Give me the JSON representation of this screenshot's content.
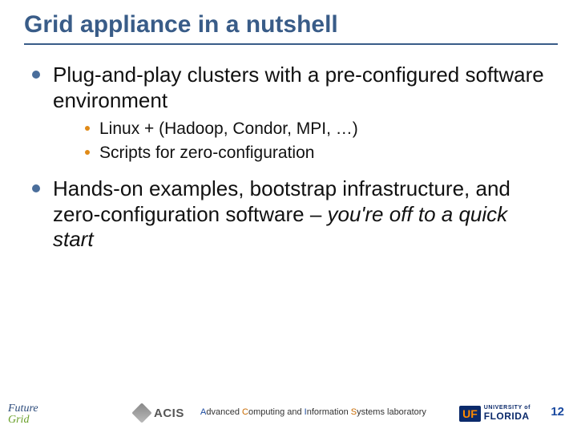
{
  "title": "Grid appliance in a nutshell",
  "bullets": [
    {
      "text_html": "Plug-and-play clusters with a pre-configured software environment",
      "sub": [
        "Linux + (Hadoop, Condor, MPI, …)",
        "Scripts for zero-configuration"
      ]
    },
    {
      "text_html": "Hands-on examples, bootstrap infrastructure, and zero-configuration software – <em>you're off to a quick start</em>",
      "sub": []
    }
  ],
  "footer": {
    "future_grid": {
      "line1": "Future",
      "line2": "Grid"
    },
    "acis": "ACIS",
    "lab_parts": {
      "A": "A",
      "dvanced": "dvanced ",
      "C": "C",
      "omputing_and": "omputing and ",
      "I": "I",
      "nformation": "nformation ",
      "S": "S",
      "ystems_lab": "ystems laboratory"
    },
    "uf": {
      "box": "UF",
      "uni": "UNIVERSITY of",
      "word": "FLORIDA"
    },
    "page": "12"
  }
}
